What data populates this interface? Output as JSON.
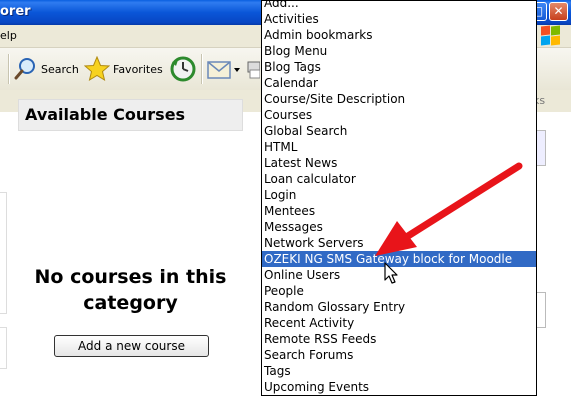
{
  "window": {
    "title_fragment": "orer",
    "max_glyph": "□",
    "close_glyph": "✕"
  },
  "menubar": {
    "menu_fragment": "elp"
  },
  "toolbar": {
    "search_label": "Search",
    "favorites_label": "Favorites"
  },
  "address_bar": {
    "links_fragment": "nks"
  },
  "course_block": {
    "title": "Available Courses",
    "empty_message": "No courses in this category",
    "add_button_label": "Add a new course"
  },
  "right_edge": {
    "char": ")"
  },
  "block_dropdown": {
    "items": [
      "Add...",
      "Activities",
      "Admin bookmarks",
      "Blog Menu",
      "Blog Tags",
      "Calendar",
      "Course/Site Description",
      "Courses",
      "Global Search",
      "HTML",
      "Latest News",
      "Loan calculator",
      "Login",
      "Mentees",
      "Messages",
      "Network Servers",
      "OZEKI NG SMS Gateway block for Moodle",
      "Online Users",
      "People",
      "Random Glossary Entry",
      "Recent Activity",
      "Remote RSS Feeds",
      "Search Forums",
      "Tags",
      "Upcoming Events"
    ],
    "selected_index": 16
  },
  "colors": {
    "titlebar": "#0a56d8",
    "selection": "#316ac5",
    "annotation_arrow": "#e8141a"
  }
}
